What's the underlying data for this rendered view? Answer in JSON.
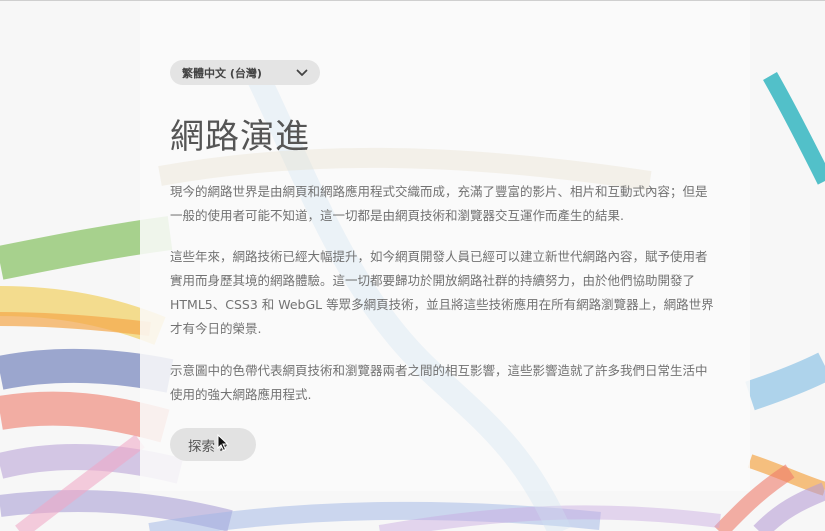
{
  "language_selector": {
    "selected": "繁體中文 (台灣)"
  },
  "main": {
    "title": "網路演進",
    "paragraphs": [
      "現今的網路世界是由網頁和網路應用程式交織而成，充滿了豐富的影片、相片和互動式內容；但是一般的使用者可能不知道，這一切都是由網頁技術和瀏覽器交互運作而產生的結果.",
      "這些年來，網路技術已經大幅提升，如今網頁開發人員已經可以建立新世代網路內容，賦予使用者實用而身歷其境的網路體驗。這一切都要歸功於開放網路社群的持續努力，由於他們協助開發了 HTML5、CSS3 和 WebGL 等眾多網頁技術，並且將這些技術應用在所有網路瀏覽器上，網路世界才有今日的榮景.",
      "示意圖中的色帶代表網頁技術和瀏覽器兩者之間的相互影響，這些影響造就了許多我們日常生活中使用的強大網路應用程式."
    ],
    "explore_label": "探索"
  },
  "colors": {
    "background": "#f7f7f7",
    "text_title": "#555555",
    "text_body": "#727272",
    "button_bg": "#e2e2e2",
    "ribbon_teal": "#3fb9c3",
    "ribbon_blue": "#8fc3e6",
    "ribbon_orange": "#f4a64a",
    "ribbon_yellow": "#f2d36b",
    "ribbon_red": "#ef7b6a",
    "ribbon_purple": "#b79ed6",
    "ribbon_green": "#8cc46a",
    "ribbon_navy": "#5d6fb3"
  },
  "icons": {
    "language_dropdown": "chevron-down-icon",
    "explore_arrow": "chevron-right-icon",
    "cursor": "mouse-pointer-icon"
  }
}
